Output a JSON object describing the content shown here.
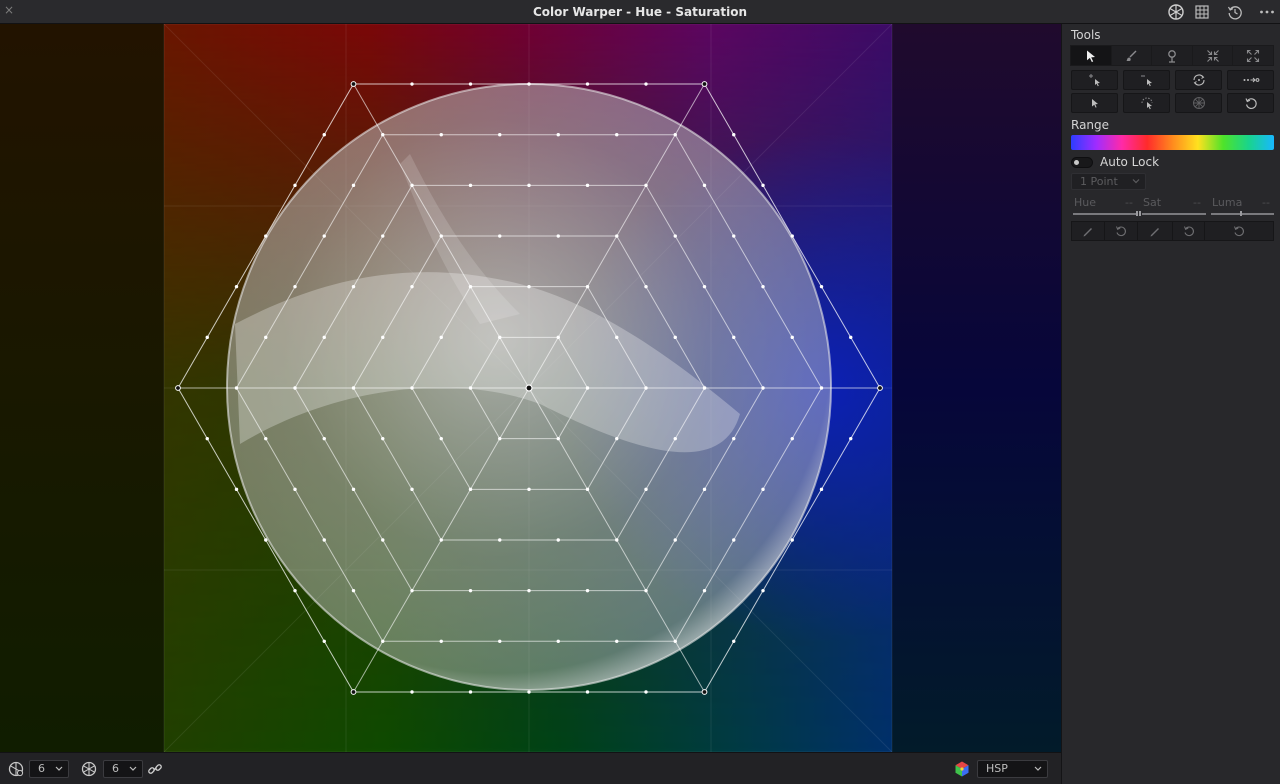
{
  "window": {
    "title": "Color Warper - Hue - Saturation",
    "close_glyph": "×",
    "header_icons": [
      "color-warper-icon",
      "grid-icon",
      "history-icon",
      "more-options-icon"
    ]
  },
  "viewer": {
    "mesh": {
      "hue_divisions": 6,
      "saturation_rings": 6
    }
  },
  "bottom_bar": {
    "hue_points_value": "6",
    "sat_points_value": "6",
    "link_icon": "link-icon",
    "color_space_icon": "color-cube-icon",
    "color_space_value": "HSP"
  },
  "panel": {
    "tools_label": "Tools",
    "tool_row_1": [
      "pointer-select-icon",
      "brush-icon",
      "pin-icon",
      "collapse-icon",
      "expand-icon"
    ],
    "tool_row_2": [
      "add-point-icon",
      "remove-point-icon",
      "rotate-points-icon",
      "push-points-icon"
    ],
    "tool_row_3": [
      "select-point-icon",
      "magnet-icon",
      "convergence-icon",
      "reset-icon"
    ],
    "range_label": "Range",
    "range_colors": [
      "#2d3dff",
      "#a02cff",
      "#ff2aa8",
      "#ff2b2b",
      "#ff8a1e",
      "#ffe11f",
      "#4ee32a",
      "#19d48c",
      "#18b8ff"
    ],
    "auto_lock_label": "Auto Lock",
    "points_select": "1 Point",
    "sliders": [
      {
        "label": "Hue",
        "dash": "--"
      },
      {
        "label": "Sat",
        "dash": "--"
      },
      {
        "label": "Luma",
        "dash": "--"
      }
    ],
    "bottom_tools": [
      "hue-pencil-icon",
      "hue-reset-icon",
      "sat-pencil-icon",
      "sat-reset-icon",
      "reset-all-icon"
    ]
  }
}
